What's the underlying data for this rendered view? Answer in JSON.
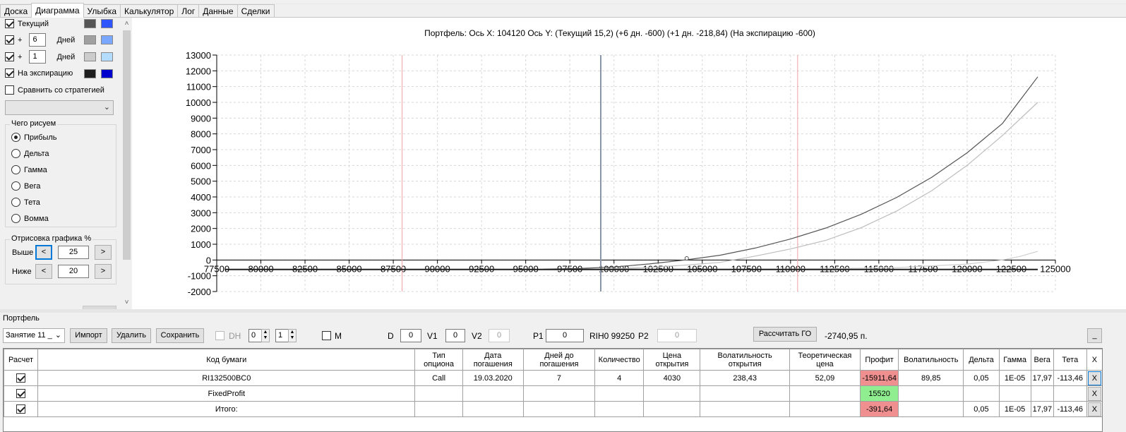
{
  "tabs": [
    "Доска",
    "Диаграмма",
    "Улыбка",
    "Калькулятор",
    "Лог",
    "Данные",
    "Сделки"
  ],
  "active_tab": 1,
  "left_panel": {
    "series": [
      {
        "label": "Текущий",
        "checked": true,
        "color_a": "#555555",
        "color_b": "#2f55ff"
      },
      {
        "plus": "+",
        "days": "6",
        "days_label": "Дней",
        "checked": true,
        "color_a": "#a0a0a0",
        "color_b": "#7aa7ff"
      },
      {
        "plus": "+",
        "days": "1",
        "days_label": "Дней",
        "checked": true,
        "color_a": "#cccccc",
        "color_b": "#b3dcff"
      },
      {
        "label": "На экспирацию",
        "checked": true,
        "color_a": "#1e1e1e",
        "color_b": "#0000cc"
      }
    ],
    "compare_label": "Сравнить со стратегией",
    "draw_group": {
      "title": "Чего рисуем",
      "options": [
        "Прибыль",
        "Дельта",
        "Гамма",
        "Вега",
        "Тета",
        "Вомма"
      ],
      "selected": 0
    },
    "range_group": {
      "title": "Отрисовка графика %",
      "above_label": "Выше",
      "above_value": "25",
      "below_label": "Ниже",
      "below_value": "20",
      "dec": "<",
      "inc": ">"
    }
  },
  "chart_title": "Портфель: Ось X: 104120 Ось Y:  (Текущий 15,2)  (+6 дн. -600)  (+1 дн. -218,84)  (На экспирацию -600)",
  "chart_data": {
    "type": "line",
    "title": "Портфель: Ось X: 104120 Ось Y:  (Текущий 15,2)  (+6 дн. -600)  (+1 дн. -218,84)  (На экспирацию -600)",
    "xlim": [
      77500,
      125000
    ],
    "ylim": [
      -2000,
      13000
    ],
    "x_ticks": [
      77500,
      80000,
      82500,
      85000,
      87500,
      90000,
      92500,
      95000,
      97500,
      100000,
      102500,
      105000,
      107500,
      110000,
      112500,
      115000,
      117500,
      120000,
      122500,
      125000
    ],
    "y_ticks": [
      -2000,
      -1000,
      0,
      1000,
      2000,
      3000,
      4000,
      5000,
      6000,
      7000,
      8000,
      9000,
      10000,
      11000,
      12000,
      13000
    ],
    "grid": true,
    "vertical_lines": [
      {
        "x": 99250,
        "color": "#8a96a8"
      },
      {
        "x": 88000,
        "color": "#f2a0a0"
      },
      {
        "x": 110400,
        "color": "#f2a0a0"
      }
    ],
    "marker": {
      "x": 104120,
      "y": 15.2
    },
    "series": [
      {
        "color": "#555555",
        "x": [
          96000,
          98000,
          100000,
          102000,
          104120,
          106000,
          108000,
          110000,
          112000,
          114000,
          116000,
          118000,
          120000,
          122000,
          124000
        ],
        "y": [
          -580,
          -540,
          -440,
          -250,
          15,
          300,
          760,
          1330,
          2030,
          2900,
          3960,
          5250,
          6800,
          8660,
          11620
        ]
      },
      {
        "color": "#bdbdbd",
        "x": [
          98000,
          100000,
          102000,
          104000,
          106000,
          108000,
          110000,
          112000,
          114000,
          116000,
          118000,
          120000,
          122000,
          124000
        ],
        "y": [
          -600,
          -560,
          -470,
          -330,
          -150,
          250,
          700,
          1250,
          2050,
          3100,
          4400,
          6000,
          7900,
          10000
        ]
      },
      {
        "color": "#cfcfcf",
        "x": [
          100000,
          104000,
          108000,
          112000,
          116000,
          120000,
          122000,
          123000,
          124000
        ],
        "y": [
          -600,
          -595,
          -585,
          -560,
          -480,
          -260,
          0,
          230,
          550
        ]
      },
      {
        "color": "#1e1e1e",
        "x": [
          78000,
          124000
        ],
        "y": [
          -600,
          -600
        ]
      }
    ]
  },
  "portfolio": {
    "section_label": "Портфель",
    "session": "Занятие 11 _",
    "import": "Импорт",
    "delete": "Удалить",
    "save": "Сохранить",
    "dh_label": "DH",
    "dh_spin1": "0",
    "dh_spin2": "1",
    "m_label": "M",
    "d_label": "D",
    "d_value": "0",
    "v1_label": "V1",
    "v1_value": "0",
    "v2_label": "V2",
    "v2_value": "0",
    "p1_label": "P1",
    "p1_value": "0",
    "rih": "RIH0 99250",
    "p2_label": "P2",
    "p2_value": "0",
    "calc_go": "Рассчитать ГО",
    "go_value": "-2740,95 п.",
    "minimize": "_",
    "columns": [
      "Расчет",
      "Код бумаги",
      "Тип опциона",
      "Дата погашения",
      "Дней до погашения",
      "Количество",
      "Цена открытия",
      "Волатильность открытия",
      "Теоретическая цена",
      "Профит",
      "Волатильность",
      "Дельта",
      "Гамма",
      "Вега",
      "Тета",
      "X"
    ],
    "rows": [
      {
        "calc": true,
        "code": "RI132500BC0",
        "type": "Call",
        "date": "19.03.2020",
        "days": "7",
        "qty": "4",
        "open_price": "4030",
        "open_vol": "238,43",
        "theo": "52,09",
        "profit": "-15911,64",
        "profit_sign": "neg",
        "vol": "89,85",
        "delta": "0,05",
        "gamma": "1E-05",
        "vega": "17,97",
        "theta": "-113,46",
        "x": "X"
      },
      {
        "calc": true,
        "code": "FixedProfit",
        "type": "",
        "date": "",
        "days": "",
        "qty": "",
        "open_price": "",
        "open_vol": "",
        "theo": "",
        "profit": "15520",
        "profit_sign": "pos",
        "vol": "",
        "delta": "",
        "gamma": "",
        "vega": "",
        "theta": "",
        "x": "X"
      },
      {
        "calc": true,
        "code": "Итого:",
        "type": "",
        "date": "",
        "days": "",
        "qty": "",
        "open_price": "",
        "open_vol": "",
        "theo": "",
        "profit": "-391,64",
        "profit_sign": "neg",
        "vol": "",
        "delta": "0,05",
        "gamma": "1E-05",
        "vega": "17,97",
        "theta": "-113,46",
        "x": "X"
      }
    ]
  }
}
